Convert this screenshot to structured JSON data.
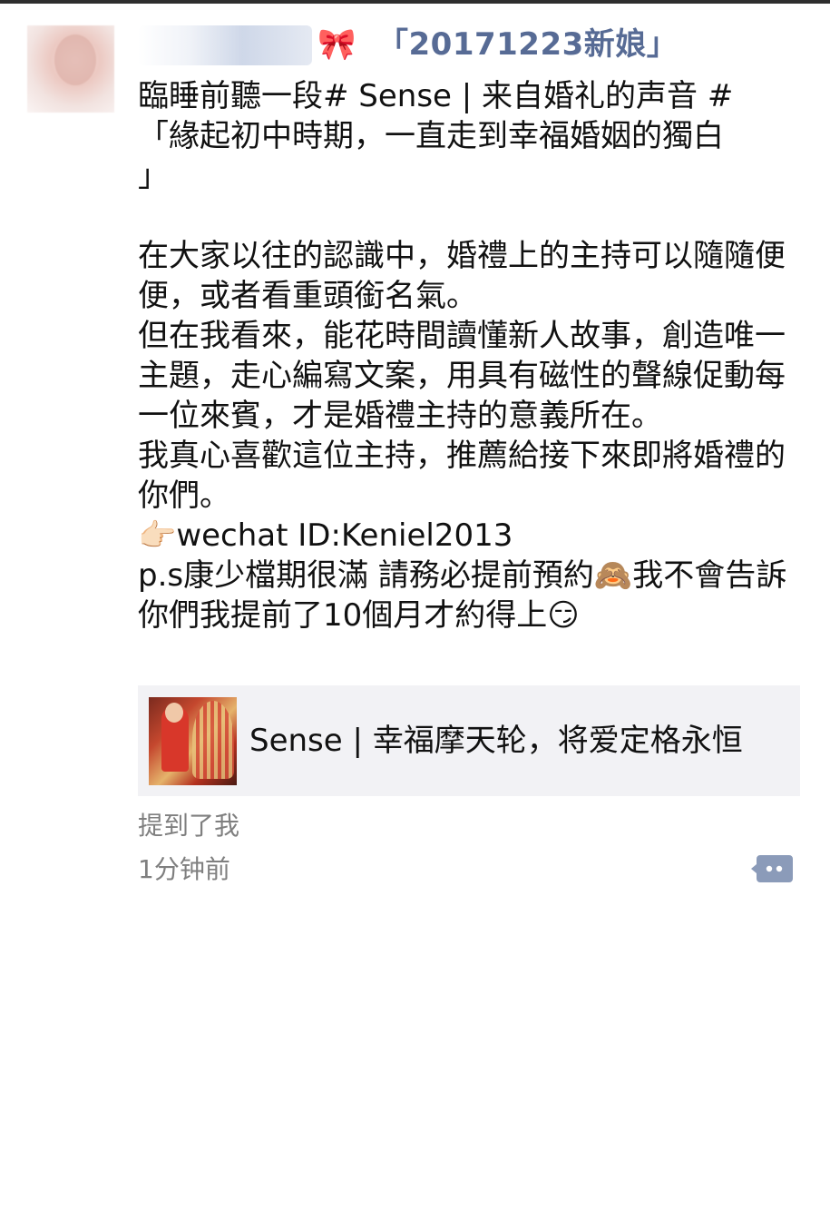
{
  "post": {
    "author_name": "「20171223新娘」",
    "author_emoji": "🎀",
    "content": "臨睡前聽一段# Sense | 来自婚礼的声音 #\n「緣起初中時期，一直走到幸福婚姻的獨白\n」\n\n在大家以往的認識中，婚禮上的主持可以隨隨便便，或者看重頭銜名氣。\n但在我看來，能花時間讀懂新人故事，創造唯一主題，走心編寫文案，用具有磁性的聲線促動每一位來賓，才是婚禮主持的意義所在。\n我真心喜歡這位主持，推薦給接下來即將婚禮的你們。\n👉🏻wechat ID:Keniel2013\np.s康少檔期很滿 請務必提前預約🙈我不會告訴你們我提前了10個月才約得上😏",
    "link_title": "Sense | 幸福摩天轮，将爱定格永恒",
    "mention": "提到了我",
    "time": "1分钟前"
  },
  "colors": {
    "name": "#576b95",
    "meta": "#7f7f7f",
    "card_bg": "#f2f2f5",
    "comment_icon": "#8b9bb9"
  }
}
